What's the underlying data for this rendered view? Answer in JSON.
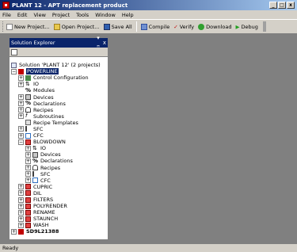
{
  "window": {
    "title": "PLANT 12 - APT replacement product"
  },
  "window_controls": [
    "_",
    "□",
    "x"
  ],
  "menu": [
    "File",
    "Edit",
    "View",
    "Project",
    "Tools",
    "Window",
    "Help"
  ],
  "toolbar": {
    "new_project": "New Project...",
    "open_project": "Open Project...",
    "save_all": "Save All",
    "compile": "Compile",
    "verify": "Verify",
    "download": "Download",
    "debug": "Debug"
  },
  "explorer": {
    "title": "Solution Explorer",
    "pin": "▾ ꟸ",
    "close": "x",
    "solution": "Solution 'PLANT 12' (2 projects)",
    "powerline": "POWERLINE",
    "powerline_children": [
      "Control Configuration",
      "IO",
      "Modules",
      "Devices",
      "Declarations",
      "Recipes",
      "Subroutines",
      "Recipe Templates",
      "SFC",
      "CFC"
    ],
    "blowdown": "BLOWDOWN",
    "blowdown_children": [
      "IO",
      "Devices",
      "Declarations",
      "Recipes",
      "SFC",
      "CFC"
    ],
    "units": [
      "CUPRIC",
      "DIL",
      "FILTERS",
      "POLYRENDER",
      "RENAME",
      "STAUNCH",
      "WASH"
    ],
    "second_project": "SD9L21388"
  },
  "status": {
    "text": "Ready"
  },
  "colors": {
    "title_bar": "#0a246a",
    "selection": "#0a246a",
    "project_icon": "#c00000"
  }
}
